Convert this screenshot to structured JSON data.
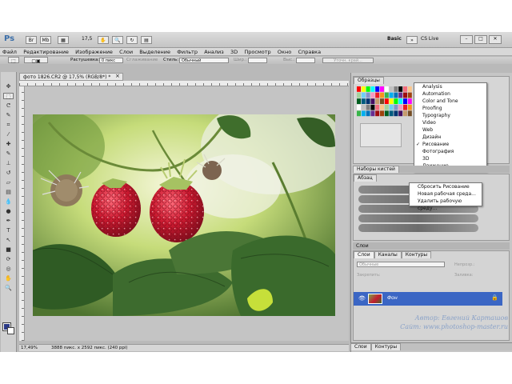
{
  "app": {
    "logo": "Ps",
    "zoom": "17,5",
    "workspace": "Basic",
    "cs_live": "CS Live"
  },
  "window_controls": [
    "–",
    "□",
    "✕"
  ],
  "menu": [
    "Файл",
    "Редактирование",
    "Изображение",
    "Слои",
    "Выделение",
    "Фильтр",
    "Анализ",
    "3D",
    "Просмотр",
    "Окно",
    "Справка"
  ],
  "options_bar": {
    "feather_label": "Растушевка:",
    "feather_value": "0 пикс",
    "smooth_label": "Сглаживание",
    "style_label": "Стиль:",
    "style_value": "Обычный",
    "width_label": "Шир.:",
    "height_label": "Выс.:",
    "refine_button": "Уточн. край..."
  },
  "document": {
    "tab_title": "фото 1826.CR2 @ 17,5% (RGB/8*) *",
    "close": "×",
    "status_zoom": "17,49%",
    "status_info": "3888 пикс. x 2592 пикс. (240 ppi)"
  },
  "swatches_panel": {
    "tab": "Образцы"
  },
  "workspace_menu": {
    "items": [
      {
        "label": "Analysis",
        "checked": false
      },
      {
        "label": "Automation",
        "checked": false
      },
      {
        "label": "Color and Tone",
        "checked": false
      },
      {
        "label": "Proofing",
        "checked": false
      },
      {
        "label": "Typography",
        "checked": false
      },
      {
        "label": "Video",
        "checked": false
      },
      {
        "label": "Web",
        "checked": false
      },
      {
        "label": "Дизайн",
        "checked": false
      },
      {
        "label": "Рисование",
        "checked": true
      },
      {
        "label": "Фотография",
        "checked": false
      },
      {
        "label": "3D",
        "checked": false
      },
      {
        "label": "Движение",
        "checked": false
      }
    ]
  },
  "brushes_panel": {
    "tab": "Наборы кистей"
  },
  "brush_panel": {
    "tab": "Абзац"
  },
  "reset_menu": {
    "items": [
      "Сбросить Рисование",
      "Новая рабочая среда...",
      "Удалить рабочую среду..."
    ]
  },
  "layers_panel": {
    "title": "Слои",
    "tabs": [
      "Слои",
      "Каналы",
      "Контуры"
    ],
    "blend_mode": "Обычные",
    "opacity_label": "Непрозр.:",
    "lock_label": "Закрепить:",
    "fill_label": "Заливка:",
    "layer_name": "Фон"
  },
  "bottom_tabs": [
    "Слои",
    "Контуры"
  ],
  "watermark": {
    "author": "Автор: Евгений Карташов",
    "site": "Сайт: www.photoshop-master.ru"
  },
  "colors": {
    "accent": "#3b66c4",
    "foreground_swatch": "#2b3a86"
  }
}
